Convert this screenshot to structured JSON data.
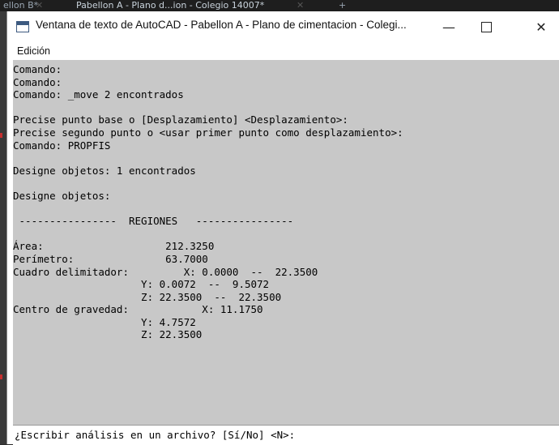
{
  "background_tabs": {
    "tab_left": "ellon B*",
    "tab_active": "Pabellon A - Plano d...ion - Colegio 14007*",
    "new_tab": "+"
  },
  "window": {
    "title": "Ventana de texto de AutoCAD - Pabellon A - Plano de cimentacion - Colegi...",
    "minimize": "—",
    "close": "✕"
  },
  "menu": {
    "items": [
      "Edición"
    ]
  },
  "console": {
    "lines": [
      "Comando:",
      "Comando:",
      "Comando: _move 2 encontrados",
      "",
      "Precise punto base o [Desplazamiento] <Desplazamiento>:",
      "Precise segundo punto o <usar primer punto como desplazamiento>:",
      "Comando: PROPFIS",
      "",
      "Designe objetos: 1 encontrados",
      "",
      "Designe objetos:",
      "",
      " ----------------  REGIONES   ----------------",
      "",
      "Área:                    212.3250",
      "Perímetro:               63.7000",
      "Cuadro delimitador:         X: 0.0000  --  22.3500",
      "                     Y: 0.0072  --  9.5072",
      "                     Z: 22.3500  --  22.3500",
      "Centro de gravedad:            X: 11.1750",
      "                     Y: 4.7572",
      "                     Z: 22.3500"
    ]
  },
  "prompt": {
    "text": "¿Escribir análisis en un archivo? [Sí/No] <N>:"
  },
  "colors": {
    "console_bg": "#c8c8c8",
    "prompt_bg": "#ffffff",
    "app_icon": "#3d5a80"
  }
}
